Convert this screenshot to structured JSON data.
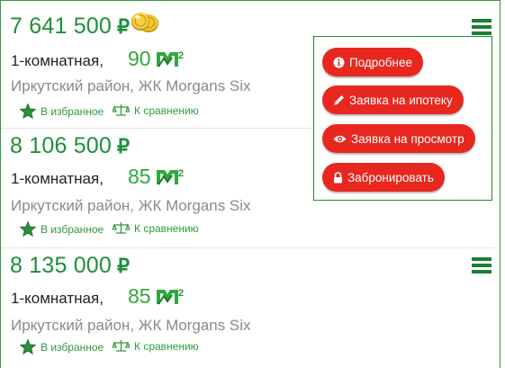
{
  "listings": [
    {
      "price": "7 641 500",
      "currency": "₽",
      "rooms": "1-комнатная,",
      "area": "90",
      "area_unit_icon": "square-meter-icon",
      "address": "Иркутский район, ЖК Morgans Six",
      "favorite_label": "В избранное",
      "compare_label": "К сравнению",
      "has_coins_icon": true,
      "has_menu": true
    },
    {
      "price": "8 106 500",
      "currency": "₽",
      "rooms": "1-комнатная,",
      "area": "85",
      "area_unit_icon": "square-meter-icon",
      "address": "Иркутский район, ЖК Morgans Six",
      "favorite_label": "В избранное",
      "compare_label": "К сравнению",
      "has_coins_icon": false,
      "has_menu": false
    },
    {
      "price": "8 135 000",
      "currency": "₽",
      "rooms": "1-комнатная,",
      "area": "85",
      "area_unit_icon": "square-meter-icon",
      "address": "Иркутский район, ЖК Morgans Six",
      "favorite_label": "В избранное",
      "compare_label": "К сравнению",
      "has_coins_icon": false,
      "has_menu": true
    }
  ],
  "popup": {
    "buttons": [
      {
        "label": "Подробнее",
        "icon": "info-icon"
      },
      {
        "label": "Заявка на ипотеку",
        "icon": "pencil-icon"
      },
      {
        "label": "Заявка на просмотр",
        "icon": "eye-icon"
      },
      {
        "label": "Забронировать",
        "icon": "lock-icon"
      }
    ]
  },
  "colors": {
    "price_green": "#1f8f3a",
    "area_green": "#2eaa3c",
    "menu_green": "#1e7e34",
    "button_red": "#e8271f",
    "border_green": "#2e9a44"
  }
}
